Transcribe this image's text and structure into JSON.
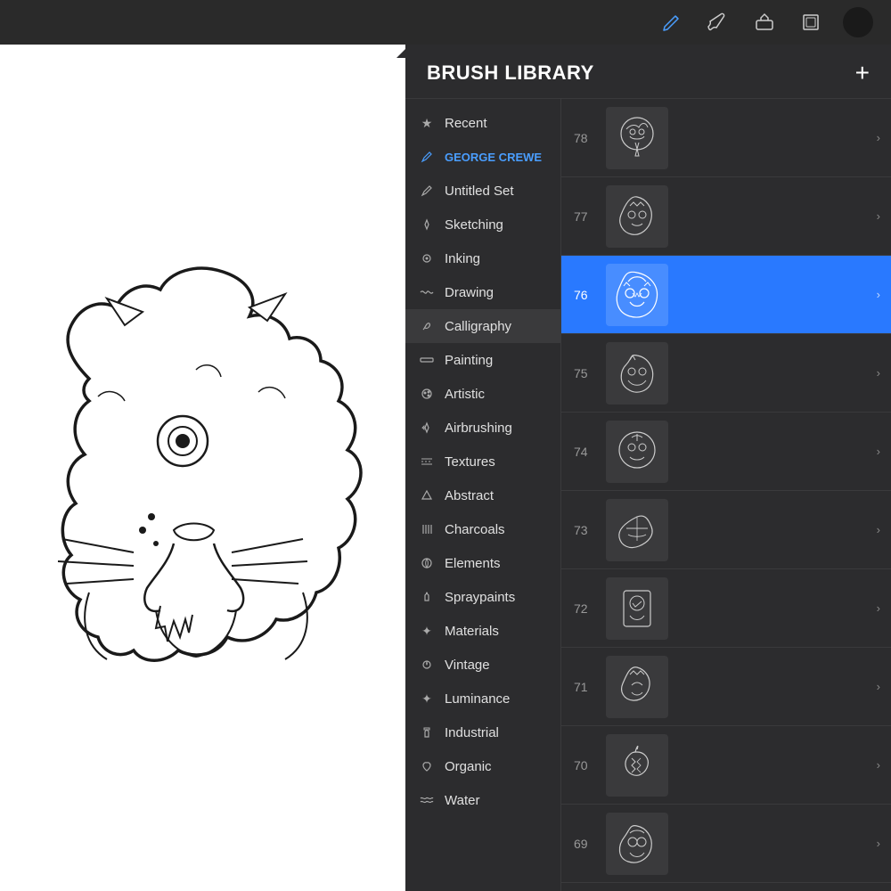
{
  "toolbar": {
    "title": "Brush Library",
    "tools": [
      {
        "name": "pencil",
        "icon": "✏",
        "active": true
      },
      {
        "name": "brush",
        "icon": "🖌",
        "active": false
      },
      {
        "name": "eraser",
        "icon": "◻",
        "active": false
      },
      {
        "name": "layers",
        "icon": "⧉",
        "active": false
      },
      {
        "name": "avatar",
        "icon": "",
        "active": false
      }
    ]
  },
  "panel": {
    "title": "BRUSH LIBRARY",
    "add_label": "+"
  },
  "categories": [
    {
      "id": "recent",
      "label": "Recent",
      "icon": "★",
      "iconType": "star"
    },
    {
      "id": "george-crewe",
      "label": "GEORGE CREWE",
      "icon": "✒",
      "iconType": "pen",
      "isUserSet": true
    },
    {
      "id": "untitled-set",
      "label": "Untitled Set",
      "icon": "✒",
      "iconType": "pen"
    },
    {
      "id": "sketching",
      "label": "Sketching",
      "icon": "△",
      "iconType": "pencil"
    },
    {
      "id": "inking",
      "label": "Inking",
      "icon": "◉",
      "iconType": "ink"
    },
    {
      "id": "drawing",
      "label": "Drawing",
      "icon": "∿",
      "iconType": "draw"
    },
    {
      "id": "calligraphy",
      "label": "Calligraphy",
      "icon": "𝒶",
      "iconType": "calli"
    },
    {
      "id": "painting",
      "label": "Painting",
      "icon": "▬",
      "iconType": "paint"
    },
    {
      "id": "artistic",
      "label": "Artistic",
      "icon": "🎨",
      "iconType": "art"
    },
    {
      "id": "airbrushing",
      "label": "Airbrushing",
      "icon": "△",
      "iconType": "air"
    },
    {
      "id": "textures",
      "label": "Textures",
      "icon": "▦",
      "iconType": "tex"
    },
    {
      "id": "abstract",
      "label": "Abstract",
      "icon": "△",
      "iconType": "abs"
    },
    {
      "id": "charcoals",
      "label": "Charcoals",
      "icon": "⦀",
      "iconType": "char"
    },
    {
      "id": "elements",
      "label": "Elements",
      "icon": "☯",
      "iconType": "elem"
    },
    {
      "id": "spraypaints",
      "label": "Spraypaints",
      "icon": "⬡",
      "iconType": "spray"
    },
    {
      "id": "materials",
      "label": "Materials",
      "icon": "✦",
      "iconType": "mat"
    },
    {
      "id": "vintage",
      "label": "Vintage",
      "icon": "✦",
      "iconType": "vint"
    },
    {
      "id": "luminance",
      "label": "Luminance",
      "icon": "✦",
      "iconType": "lum"
    },
    {
      "id": "industrial",
      "label": "Industrial",
      "icon": "⬆",
      "iconType": "ind"
    },
    {
      "id": "organic",
      "label": "Organic",
      "icon": "🌿",
      "iconType": "org"
    },
    {
      "id": "water",
      "label": "Water",
      "icon": "≋",
      "iconType": "water"
    }
  ],
  "brushes": [
    {
      "number": "78",
      "selected": false
    },
    {
      "number": "77",
      "selected": false
    },
    {
      "number": "76",
      "selected": true
    },
    {
      "number": "75",
      "selected": false
    },
    {
      "number": "74",
      "selected": false
    },
    {
      "number": "73",
      "selected": false
    },
    {
      "number": "72",
      "selected": false
    },
    {
      "number": "71",
      "selected": false
    },
    {
      "number": "70",
      "selected": false
    },
    {
      "number": "69",
      "selected": false
    }
  ]
}
